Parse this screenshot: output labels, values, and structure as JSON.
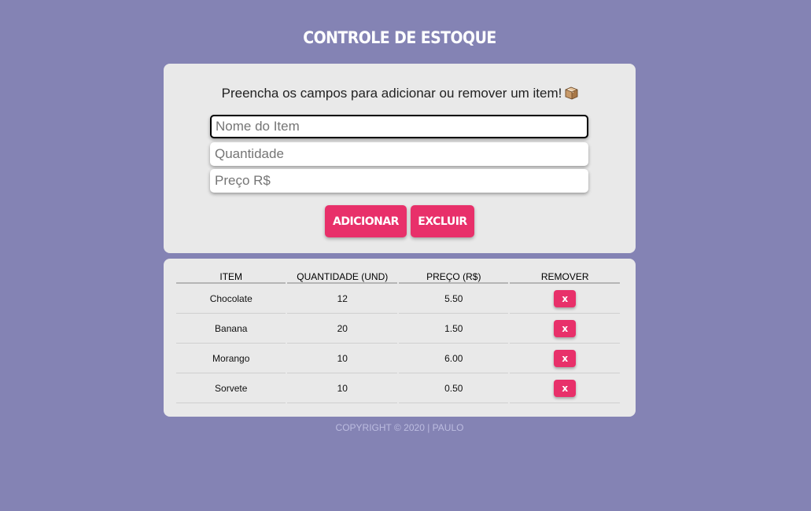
{
  "header": {
    "title": "CONTROLE DE ESTOQUE"
  },
  "form": {
    "instruction": "Preencha os campos para adicionar ou remover um item!",
    "instruction_icon": "package-box-icon",
    "fields": [
      {
        "placeholder": "Nome do Item",
        "value": ""
      },
      {
        "placeholder": "Quantidade",
        "value": ""
      },
      {
        "placeholder": "Preço R$",
        "value": ""
      }
    ],
    "add_label": "ADICIONAR",
    "delete_label": "EXCLUIR"
  },
  "table": {
    "headers": [
      "ITEM",
      "QUANTIDADE (UND)",
      "PREÇO (R$)",
      "REMOVER"
    ],
    "rows": [
      {
        "item": "Chocolate",
        "quantity": "12",
        "price": "5.50",
        "remove_label": "x"
      },
      {
        "item": "Banana",
        "quantity": "20",
        "price": "1.50",
        "remove_label": "x"
      },
      {
        "item": "Morango",
        "quantity": "10",
        "price": "6.00",
        "remove_label": "x"
      },
      {
        "item": "Sorvete",
        "quantity": "10",
        "price": "0.50",
        "remove_label": "x"
      }
    ]
  },
  "footer": {
    "text": "COPYRIGHT © 2020 | PAULO"
  },
  "colors": {
    "background": "#8483b4",
    "card": "#e9e9e9",
    "accent": "#e8306a"
  }
}
